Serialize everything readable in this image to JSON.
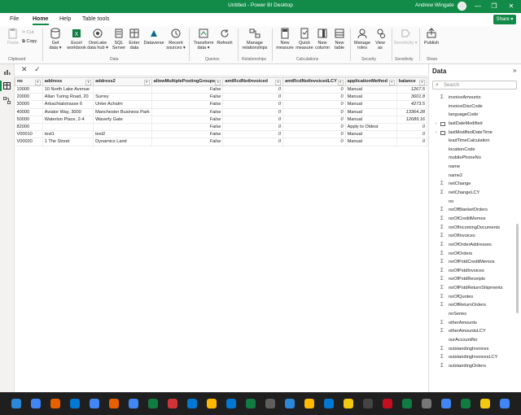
{
  "window": {
    "title": "Untitled - Power BI Desktop",
    "user": "Andrew Wingate",
    "minimize": "—",
    "maximize": "❐",
    "close": "✕"
  },
  "menu": {
    "file": "File",
    "home": "Home",
    "help": "Help",
    "table_tools": "Table tools",
    "share": "Share"
  },
  "ribbon": {
    "paste": "Paste",
    "cut": "Cut",
    "copy": "Copy",
    "get_data": [
      "Get",
      "data"
    ],
    "excel": [
      "Excel",
      "workbook"
    ],
    "onelake": [
      "OneLake",
      "data hub"
    ],
    "sql": [
      "SQL",
      "Server"
    ],
    "enter_data": [
      "Enter",
      "data"
    ],
    "dataverse": [
      "Dataverse",
      ""
    ],
    "recent": [
      "Recent",
      "sources"
    ],
    "transform": [
      "Transform",
      "data"
    ],
    "refresh": [
      "Refresh",
      ""
    ],
    "manage_rel": [
      "Manage",
      "relationships"
    ],
    "new_measure": [
      "New",
      "measure"
    ],
    "quick_measure": [
      "Quick",
      "measure"
    ],
    "new_column": [
      "New",
      "column"
    ],
    "new_table": [
      "New",
      "table"
    ],
    "manage_roles": [
      "Manage",
      "roles"
    ],
    "view_as": [
      "View",
      "as"
    ],
    "sensitivity": [
      "Sensitivity",
      ""
    ],
    "publish": [
      "Publish",
      ""
    ],
    "groups": {
      "clipboard": "Clipboard",
      "data": "Data",
      "queries": "Queries",
      "relationships": "Relationships",
      "calculations": "Calculations",
      "security": "Security",
      "sensitivity": "Sensitivity",
      "share": "Share"
    }
  },
  "formula": {
    "cancel": "✕",
    "commit": "✓"
  },
  "table": {
    "headers": [
      "no",
      "address",
      "address2",
      "allowMultiplePostingGroups",
      "amtRcdNotInvoiced",
      "amtRcdNotInvoicedLCY",
      "applicationMethod",
      "balance"
    ],
    "rows": [
      [
        "10000",
        "10 North Lake Avenue",
        "",
        "False",
        "0",
        "0",
        "Manual",
        "1267.5"
      ],
      [
        "20000",
        "Allan Turing Road, 20",
        "Surrey",
        "False",
        "0",
        "0",
        "Manual",
        "3601.8"
      ],
      [
        "30000",
        "Arbachtalstrasse 6",
        "Unter Achalm",
        "False",
        "0",
        "0",
        "Manual",
        "4273.5"
      ],
      [
        "40000",
        "Aviator Way, 3000",
        "Manchester Business Park",
        "False",
        "0",
        "0",
        "Manual",
        "13364.28"
      ],
      [
        "50000",
        "Waterloo Place, 2-4",
        "Waverly Gate",
        "False",
        "0",
        "0",
        "Manual",
        "12689.16"
      ],
      [
        "82000",
        "",
        "",
        "False",
        "0",
        "0",
        "Apply to Oldest",
        "0"
      ],
      [
        "V00010",
        "test1",
        "test2",
        "False",
        "0",
        "0",
        "Manual",
        "0"
      ],
      [
        "V00020",
        "1 The Street",
        "Dynamics Land",
        "False",
        "0",
        "0",
        "Manual",
        "0"
      ]
    ]
  },
  "data_pane": {
    "title": "Data",
    "search_placeholder": "Search",
    "fields": [
      {
        "icon": "sigma",
        "label": "invoiceAmounts"
      },
      {
        "icon": "none",
        "label": "invoiceDiscCode"
      },
      {
        "icon": "none",
        "label": "languageCode"
      },
      {
        "icon": "calendar",
        "label": "lastDateModified"
      },
      {
        "icon": "calendar",
        "label": "lastModifiedDateTime"
      },
      {
        "icon": "none",
        "label": "leadTimeCalculation"
      },
      {
        "icon": "none",
        "label": "locationCode"
      },
      {
        "icon": "none",
        "label": "mobilePhoneNo"
      },
      {
        "icon": "none",
        "label": "name"
      },
      {
        "icon": "none",
        "label": "name2"
      },
      {
        "icon": "sigma",
        "label": "netChange"
      },
      {
        "icon": "sigma",
        "label": "netChangeLCY"
      },
      {
        "icon": "none",
        "label": "no"
      },
      {
        "icon": "sigma",
        "label": "noOfBlanketOrders"
      },
      {
        "icon": "sigma",
        "label": "noOfCreditMemos"
      },
      {
        "icon": "sigma",
        "label": "noOfIncomingDocuments"
      },
      {
        "icon": "sigma",
        "label": "noOfInvoices"
      },
      {
        "icon": "sigma",
        "label": "noOfOrderAddresses"
      },
      {
        "icon": "sigma",
        "label": "noOfOrders"
      },
      {
        "icon": "sigma",
        "label": "noOfPstdCreditMemos"
      },
      {
        "icon": "sigma",
        "label": "noOfPstdInvoices"
      },
      {
        "icon": "sigma",
        "label": "noOfPstdReceipts"
      },
      {
        "icon": "sigma",
        "label": "noOfPstdReturnShipments"
      },
      {
        "icon": "sigma",
        "label": "noOfQuotes"
      },
      {
        "icon": "sigma",
        "label": "noOfReturnOrders"
      },
      {
        "icon": "none",
        "label": "noSeries"
      },
      {
        "icon": "sigma",
        "label": "otherAmounts"
      },
      {
        "icon": "sigma",
        "label": "otherAmountsLCY"
      },
      {
        "icon": "none",
        "label": "ourAccountNo"
      },
      {
        "icon": "sigma",
        "label": "outstandingInvoices"
      },
      {
        "icon": "sigma",
        "label": "outstandingInvoicesLCY"
      },
      {
        "icon": "sigma",
        "label": "outstandingOrders"
      }
    ]
  },
  "colors": {
    "brand_green": "#118b47",
    "excel_green": "#107c41",
    "taskbar": "#1f1f1f"
  }
}
